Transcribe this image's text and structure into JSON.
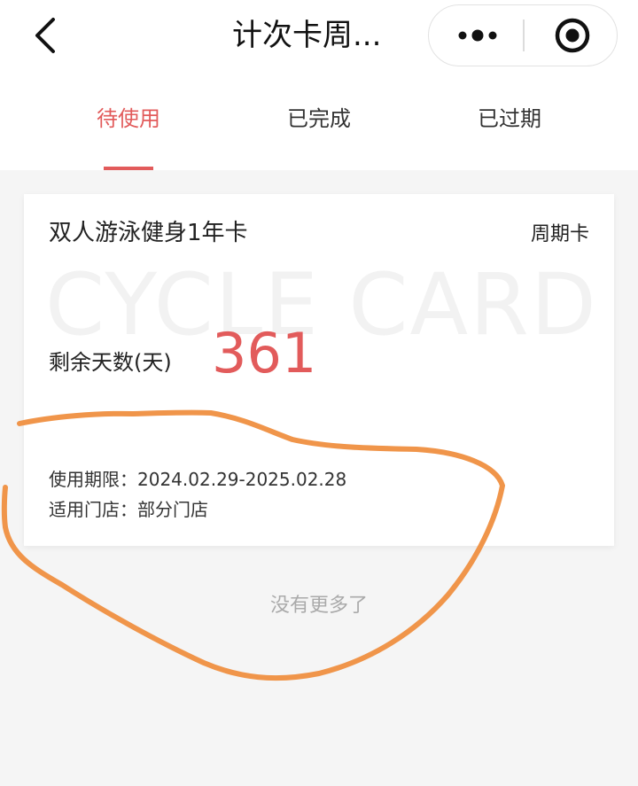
{
  "navbar": {
    "title": "计次卡周...",
    "back_icon": "chevron-left-icon",
    "more_icon": "more-dots-icon",
    "close_icon": "target-circle-icon"
  },
  "tabs": [
    {
      "label": "待使用",
      "active": true
    },
    {
      "label": "已完成",
      "active": false
    },
    {
      "label": "已过期",
      "active": false
    }
  ],
  "card": {
    "name": "双人游泳健身1年卡",
    "type": "周期卡",
    "watermark": "CYCLE CARD",
    "remaining_label": "剩余天数(天)",
    "remaining_value": "361",
    "validity_label": "使用期限：",
    "validity_value": "2024.02.29-2025.02.28",
    "stores_label": "适用门店：",
    "stores_value": "部分门店"
  },
  "footer": {
    "no_more": "没有更多了"
  },
  "colors": {
    "accent": "#e25b5b",
    "annotation": "#f0954a",
    "background": "#f5f5f5"
  }
}
